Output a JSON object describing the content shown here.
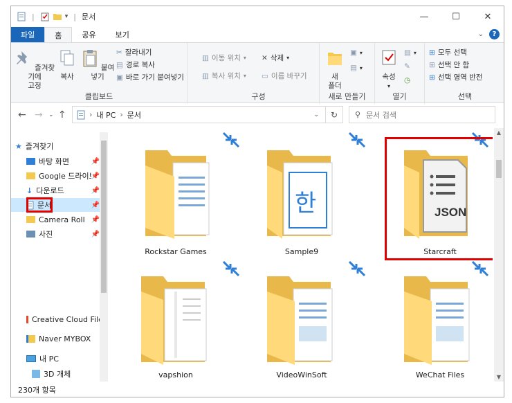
{
  "title": "문서",
  "window_controls": {
    "minimize": "—",
    "maximize": "☐",
    "close": "✕"
  },
  "tabs": [
    {
      "label": "파일"
    },
    {
      "label": "홈"
    },
    {
      "label": "공유"
    },
    {
      "label": "보기"
    }
  ],
  "ribbon": {
    "clipboard": {
      "pin_label": "즐겨찾기에\n고정",
      "copy_label": "복사",
      "paste_label": "붙여넣기",
      "cut_label": "잘라내기",
      "copy_path_label": "경로 복사",
      "paste_shortcut_label": "바로 가기 붙여넣기",
      "group_label": "클립보드"
    },
    "organize": {
      "move_to_label": "이동 위치",
      "copy_to_label": "복사 위치",
      "delete_label": "삭제",
      "rename_label": "이름 바꾸기",
      "group_label": "구성"
    },
    "new": {
      "new_folder_label": "새\n폴더",
      "group_label": "새로 만들기"
    },
    "open": {
      "properties_label": "속성",
      "group_label": "열기"
    },
    "select": {
      "select_all_label": "모두 선택",
      "select_none_label": "선택 안 함",
      "invert_label": "선택 영역 반전",
      "group_label": "선택"
    }
  },
  "address": {
    "path": [
      "내 PC",
      "문서"
    ],
    "search_placeholder": "문서 검색"
  },
  "nav": {
    "quick_access": "즐겨찾기",
    "items": [
      {
        "label": "바탕 화면",
        "pinned": true
      },
      {
        "label": "Google 드라이브",
        "pinned": true
      },
      {
        "label": "다운로드",
        "pinned": true
      },
      {
        "label": "문서",
        "pinned": true
      },
      {
        "label": "Camera Roll",
        "pinned": true
      },
      {
        "label": "사진",
        "pinned": true
      }
    ],
    "other": [
      {
        "label": "Creative Cloud Files"
      },
      {
        "label": "Naver MYBOX"
      },
      {
        "label": "내 PC"
      },
      {
        "label": "3D 개체"
      }
    ]
  },
  "files": [
    {
      "name": "Rockstar Games"
    },
    {
      "name": "Sample9"
    },
    {
      "name": "Starcraft",
      "badge": "JSON"
    },
    {
      "name": "vapshion"
    },
    {
      "name": "VideoWinSoft"
    },
    {
      "name": "WeChat Files"
    }
  ],
  "status": {
    "count": "230개 항목"
  },
  "colors": {
    "accent": "#1a66b8",
    "highlight": "#e00000",
    "folder_back": "#e8b94a",
    "folder_front": "#ffd97a"
  }
}
